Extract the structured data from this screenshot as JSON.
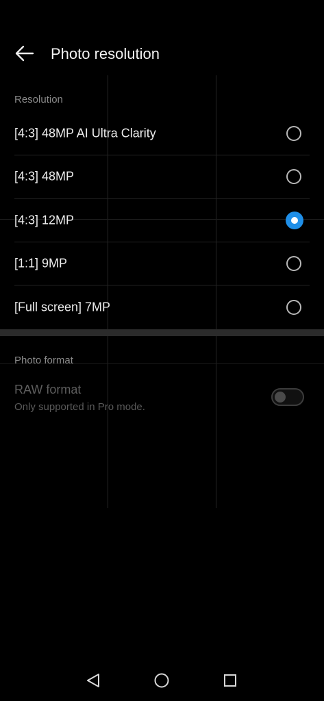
{
  "header": {
    "title": "Photo resolution",
    "back_icon": "arrow-left-icon"
  },
  "resolution_section": {
    "title": "Resolution",
    "options": [
      {
        "label": "[4:3] 48MP AI Ultra Clarity",
        "selected": false
      },
      {
        "label": "[4:3] 48MP",
        "selected": false
      },
      {
        "label": "[4:3] 12MP",
        "selected": true
      },
      {
        "label": "[1:1] 9MP",
        "selected": false
      },
      {
        "label": "[Full screen] 7MP",
        "selected": false
      }
    ]
  },
  "format_section": {
    "title": "Photo format",
    "raw": {
      "label": "RAW format",
      "subtitle": "Only supported in Pro mode.",
      "enabled": false,
      "checked": false
    }
  },
  "nav_bar": {
    "icons": [
      "triangle-back-icon",
      "circle-home-icon",
      "square-recents-icon"
    ]
  },
  "colors": {
    "accent": "#1f8fe8",
    "background": "#000000"
  }
}
